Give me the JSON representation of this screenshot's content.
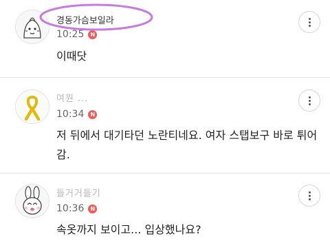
{
  "comments": [
    {
      "author": "경동가슴보일라",
      "time": "10:25",
      "badge": "N",
      "body": "이때닷"
    },
    {
      "author": "여뭔 ...",
      "time": "10:34",
      "badge": "N",
      "body": "저 뒤에서 대기타던 노란티네요. 여자 스탭보구 바로 튀어감."
    },
    {
      "author": "들거거들기",
      "time": "10:36",
      "badge": "N",
      "body": "속옷까지 보이고... 입상했나요?"
    }
  ],
  "colors": {
    "badge": "#f25a58",
    "highlight": "#c77be0",
    "divider": "#e6e6e6"
  },
  "icons": {
    "more": "more-vertical-icon"
  }
}
